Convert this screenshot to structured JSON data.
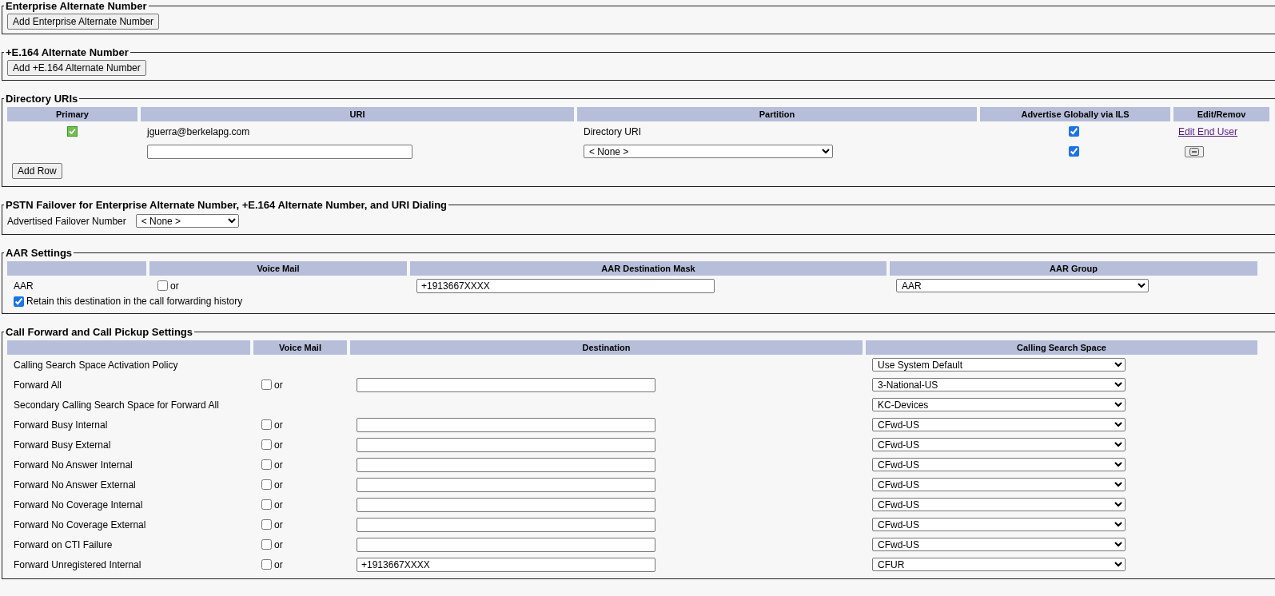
{
  "enterprise_alternate_number": {
    "legend": "Enterprise Alternate Number",
    "button": "Add Enterprise Alternate Number"
  },
  "e164_alternate_number": {
    "legend": "+E.164 Alternate Number",
    "button": "Add +E.164 Alternate Number"
  },
  "directory_uris": {
    "legend": "Directory URIs",
    "columns": [
      "Primary",
      "URI",
      "Partition",
      "Advertise Globally via ILS",
      "Edit/Remov"
    ],
    "rows": [
      {
        "kind": "existing",
        "primary": true,
        "uri": "jguerra@berkelapg.com",
        "partition": "Directory URI",
        "advertise_globally": true,
        "action": "Edit End User"
      },
      {
        "kind": "new",
        "primary": false,
        "partition": "< None >",
        "advertise_globally": true
      }
    ],
    "add_row_button": "Add Row"
  },
  "pstn_failover": {
    "legend": "PSTN Failover for Enterprise Alternate Number, +E.164 Alternate Number, and URI Dialing",
    "label": "Advertised Failover Number",
    "value": "< None >"
  },
  "aar_settings": {
    "legend": "AAR Settings",
    "columns": [
      "Voice Mail",
      "AAR Destination Mask",
      "AAR Group"
    ],
    "row": {
      "label": "AAR",
      "voice_mail": false,
      "or": "or",
      "mask": "+1913667XXXX",
      "group": "AAR"
    },
    "retain": {
      "label": "Retain this destination in the call forwarding history",
      "checked": true
    }
  },
  "call_forward": {
    "legend": "Call Forward and Call Pickup Settings",
    "columns": [
      "Voice Mail",
      "Destination",
      "Calling Search Space"
    ],
    "rows": [
      {
        "kind": "select",
        "label": "Calling Search Space Activation Policy",
        "css": "Use System Default"
      },
      {
        "kind": "forward",
        "label": "Forward All",
        "voice_mail": false,
        "or": "or",
        "css": "3-National-US"
      },
      {
        "kind": "select",
        "label": "Secondary Calling Search Space for Forward All",
        "css": "KC-Devices"
      },
      {
        "kind": "forward",
        "label": "Forward Busy Internal",
        "voice_mail": false,
        "or": "or",
        "css": "CFwd-US"
      },
      {
        "kind": "forward",
        "label": "Forward Busy External",
        "voice_mail": false,
        "or": "or",
        "css": "CFwd-US"
      },
      {
        "kind": "forward",
        "label": "Forward No Answer Internal",
        "voice_mail": false,
        "or": "or",
        "css": "CFwd-US"
      },
      {
        "kind": "forward",
        "label": "Forward No Answer External",
        "voice_mail": false,
        "or": "or",
        "css": "CFwd-US"
      },
      {
        "kind": "forward",
        "label": "Forward No Coverage Internal",
        "voice_mail": false,
        "or": "or",
        "css": "CFwd-US"
      },
      {
        "kind": "forward",
        "label": "Forward No Coverage External",
        "voice_mail": false,
        "or": "or",
        "css": "CFwd-US"
      },
      {
        "kind": "forward",
        "label": "Forward on CTI Failure",
        "voice_mail": false,
        "or": "or",
        "css": "CFwd-US"
      },
      {
        "kind": "forward",
        "label": "Forward Unregistered Internal",
        "voice_mail": false,
        "or": "or",
        "destination": "+1913667XXXX",
        "css": "CFUR"
      }
    ]
  }
}
